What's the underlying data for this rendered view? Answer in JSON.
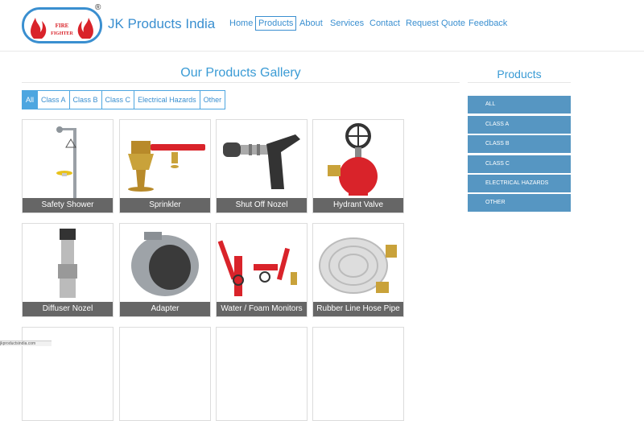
{
  "header": {
    "brand": "JK Products India",
    "logo_text": "FIRE FIGHTER",
    "registered_mark": "®",
    "nav": [
      {
        "label": "Home",
        "active": false
      },
      {
        "label": "Products",
        "active": true
      },
      {
        "label": "About",
        "active": false
      },
      {
        "label": "Services",
        "active": false
      },
      {
        "label": "Contact",
        "active": false
      },
      {
        "label": "Request Quote",
        "active": false
      },
      {
        "label": "Feedback",
        "active": false
      }
    ]
  },
  "gallery": {
    "title": "Our Products Gallery",
    "filters": [
      "All",
      "Class A",
      "Class B",
      "Class C",
      "Electrical Hazards",
      "Other"
    ],
    "active_filter": "All",
    "products": [
      {
        "name": "Safety Shower",
        "icon": "safety-shower-image"
      },
      {
        "name": "Sprinkler",
        "icon": "sprinkler-image"
      },
      {
        "name": "Shut Off Nozel",
        "icon": "shut-off-nozzle-image"
      },
      {
        "name": "Hydrant Valve",
        "icon": "hydrant-valve-image"
      },
      {
        "name": "Diffuser Nozel",
        "icon": "diffuser-nozzle-image"
      },
      {
        "name": "Adapter",
        "icon": "adapter-image"
      },
      {
        "name": "Water / Foam Monitors",
        "icon": "foam-monitor-image"
      },
      {
        "name": "Rubber Line Hose Pipe",
        "icon": "hose-pipe-image"
      }
    ]
  },
  "sidebar": {
    "title": "Products",
    "items": [
      "ALL",
      "CLASS A",
      "CLASS B",
      "CLASS C",
      "ELECTRICAL HAZARDS",
      "OTHER"
    ]
  },
  "status_bar": {
    "text": "jkproductsindia.com"
  },
  "colors": {
    "accent": "#3a8fd0",
    "sidebar": "#5696c2",
    "caption": "#666666",
    "red": "#d9232a",
    "brass": "#c9a23a"
  }
}
